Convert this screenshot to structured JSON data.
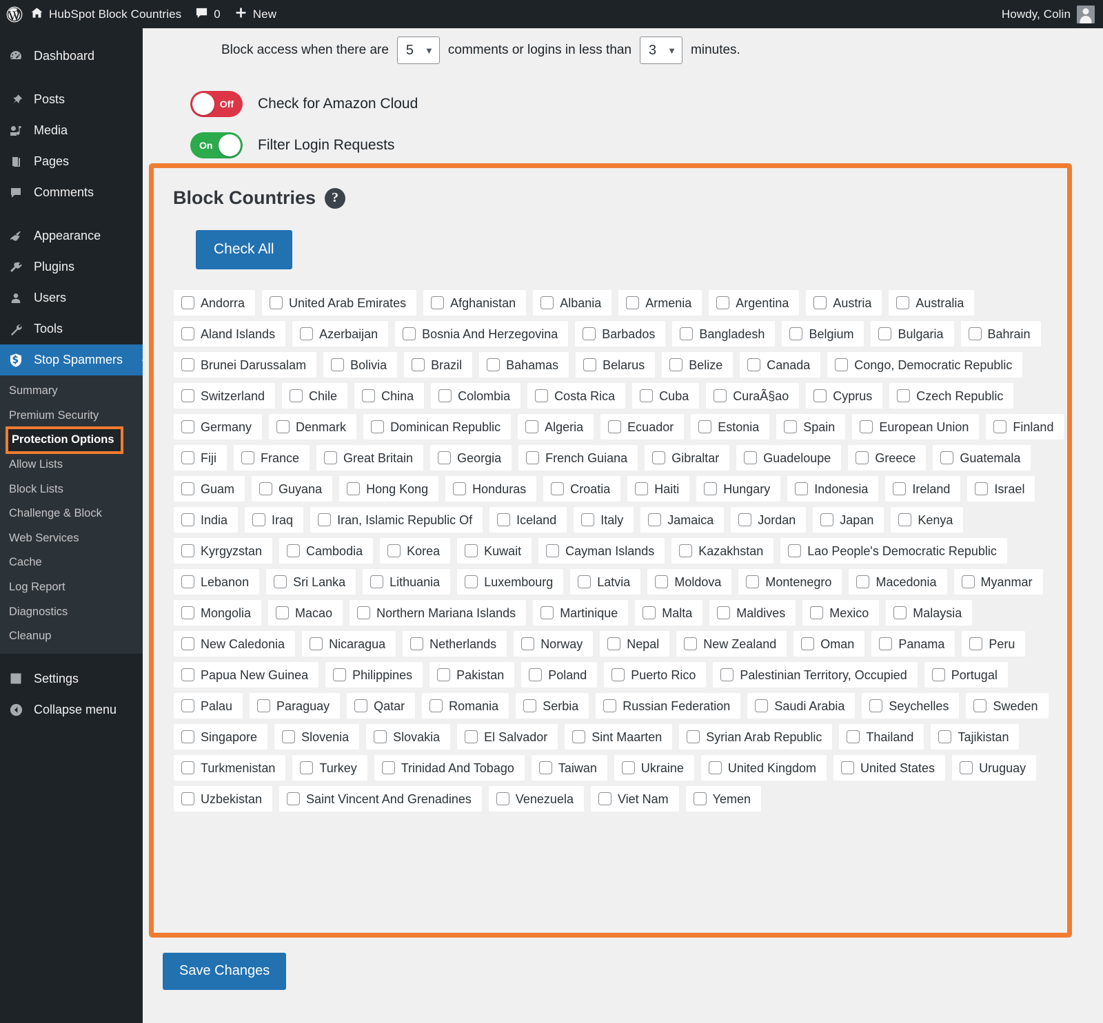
{
  "adminbar": {
    "wp_logo": "wordpress-logo-icon",
    "site_name": "HubSpot Block Countries",
    "comments_count": "0",
    "new_label": "New",
    "greeting": "Howdy, Colin"
  },
  "sidebar": {
    "items": [
      {
        "label": "Dashboard",
        "icon": "dashboard-icon"
      },
      {
        "label": "Posts",
        "icon": "pin-icon"
      },
      {
        "label": "Media",
        "icon": "media-icon"
      },
      {
        "label": "Pages",
        "icon": "pages-icon"
      },
      {
        "label": "Comments",
        "icon": "comments-icon"
      },
      {
        "label": "Appearance",
        "icon": "brush-icon"
      },
      {
        "label": "Plugins",
        "icon": "plug-icon"
      },
      {
        "label": "Users",
        "icon": "user-icon"
      },
      {
        "label": "Tools",
        "icon": "wrench-icon"
      },
      {
        "label": "Stop Spammers",
        "icon": "shield-icon"
      }
    ],
    "submenu": [
      "Summary",
      "Premium Security",
      "Protection Options",
      "Allow Lists",
      "Block Lists",
      "Challenge & Block",
      "Web Services",
      "Cache",
      "Log Report",
      "Diagnostics",
      "Cleanup"
    ],
    "highlighted_submenu": "Protection Options",
    "settings_label": "Settings",
    "collapse_label": "Collapse menu"
  },
  "topline": {
    "prefix": "Block access when there are",
    "count_value": "5",
    "middle": "comments or logins in less than",
    "minutes_value": "3",
    "suffix": "minutes."
  },
  "toggles": [
    {
      "state": "Off",
      "label": "Check for Amazon Cloud",
      "on": false
    },
    {
      "state": "On",
      "label": "Filter Login Requests",
      "on": true
    }
  ],
  "panel": {
    "title": "Block Countries",
    "help_icon": "question-mark-icon",
    "check_all_label": "Check All",
    "accent_color": "#f07c32"
  },
  "save_label": "Save Changes",
  "countries": [
    "Andorra",
    "United Arab Emirates",
    "Afghanistan",
    "Albania",
    "Armenia",
    "Argentina",
    "Austria",
    "Australia",
    "Aland Islands",
    "Azerbaijan",
    "Bosnia And Herzegovina",
    "Barbados",
    "Bangladesh",
    "Belgium",
    "Bulgaria",
    "Bahrain",
    "Brunei Darussalam",
    "Bolivia",
    "Brazil",
    "Bahamas",
    "Belarus",
    "Belize",
    "Canada",
    "Congo, Democratic Republic",
    "Switzerland",
    "Chile",
    "China",
    "Colombia",
    "Costa Rica",
    "Cuba",
    "CuraÃ§ao",
    "Cyprus",
    "Czech Republic",
    "Germany",
    "Denmark",
    "Dominican Republic",
    "Algeria",
    "Ecuador",
    "Estonia",
    "Spain",
    "European Union",
    "Finland",
    "Fiji",
    "France",
    "Great Britain",
    "Georgia",
    "French Guiana",
    "Gibraltar",
    "Guadeloupe",
    "Greece",
    "Guatemala",
    "Guam",
    "Guyana",
    "Hong Kong",
    "Honduras",
    "Croatia",
    "Haiti",
    "Hungary",
    "Indonesia",
    "Ireland",
    "Israel",
    "India",
    "Iraq",
    "Iran, Islamic Republic Of",
    "Iceland",
    "Italy",
    "Jamaica",
    "Jordan",
    "Japan",
    "Kenya",
    "Kyrgyzstan",
    "Cambodia",
    "Korea",
    "Kuwait",
    "Cayman Islands",
    "Kazakhstan",
    "Lao People's Democratic Republic",
    "Lebanon",
    "Sri Lanka",
    "Lithuania",
    "Luxembourg",
    "Latvia",
    "Moldova",
    "Montenegro",
    "Macedonia",
    "Myanmar",
    "Mongolia",
    "Macao",
    "Northern Mariana Islands",
    "Martinique",
    "Malta",
    "Maldives",
    "Mexico",
    "Malaysia",
    "New Caledonia",
    "Nicaragua",
    "Netherlands",
    "Norway",
    "Nepal",
    "New Zealand",
    "Oman",
    "Panama",
    "Peru",
    "Papua New Guinea",
    "Philippines",
    "Pakistan",
    "Poland",
    "Puerto Rico",
    "Palestinian Territory, Occupied",
    "Portugal",
    "Palau",
    "Paraguay",
    "Qatar",
    "Romania",
    "Serbia",
    "Russian Federation",
    "Saudi Arabia",
    "Seychelles",
    "Sweden",
    "Singapore",
    "Slovenia",
    "Slovakia",
    "El Salvador",
    "Sint Maarten",
    "Syrian Arab Republic",
    "Thailand",
    "Tajikistan",
    "Turkmenistan",
    "Turkey",
    "Trinidad And Tobago",
    "Taiwan",
    "Ukraine",
    "United Kingdom",
    "United States",
    "Uruguay",
    "Uzbekistan",
    "Saint Vincent And Grenadines",
    "Venezuela",
    "Viet Nam",
    "Yemen"
  ]
}
